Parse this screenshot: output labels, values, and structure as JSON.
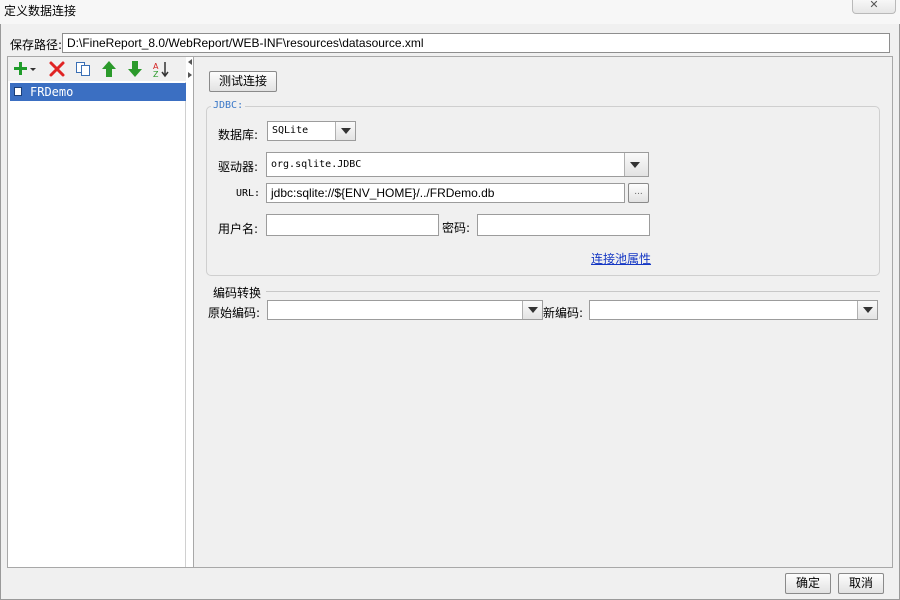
{
  "window": {
    "title": "定义数据连接",
    "close_glyph": "✕"
  },
  "path": {
    "label": "保存路径:",
    "value": "D:\\FineReport_8.0/WebReport/WEB-INF\\resources\\datasource.xml"
  },
  "toolbar": {
    "icons": [
      "add-icon",
      "delete-icon",
      "copy-icon",
      "move-up-icon",
      "move-down-icon",
      "sort-icon"
    ],
    "colors": {
      "add": "#1f9c2a",
      "delete": "#e02424",
      "copy": "#3a6fb5",
      "arrows": "#2b9a2b"
    }
  },
  "connections": {
    "items": [
      {
        "label": "FRDemo",
        "selected": true
      }
    ],
    "selected_color": "#3b6fc2"
  },
  "form": {
    "test_button": "测试连接",
    "jdbc_legend": "JDBC:",
    "database": {
      "label": "数据库:",
      "value": "SQLite"
    },
    "driver": {
      "label": "驱动器:",
      "value": "org.sqlite.JDBC"
    },
    "url": {
      "label": "URL:",
      "value": "jdbc:sqlite://${ENV_HOME}/../FRDemo.db",
      "browse": "..."
    },
    "username": {
      "label": "用户名:",
      "value": ""
    },
    "password": {
      "label": "密码:",
      "value": ""
    },
    "pool_link": "连接池属性",
    "encoding": {
      "legend": "编码转换",
      "original_label": "原始编码:",
      "original_value": "",
      "new_label": "新编码:",
      "new_value": ""
    }
  },
  "footer": {
    "ok": "确定",
    "cancel": "取消"
  }
}
